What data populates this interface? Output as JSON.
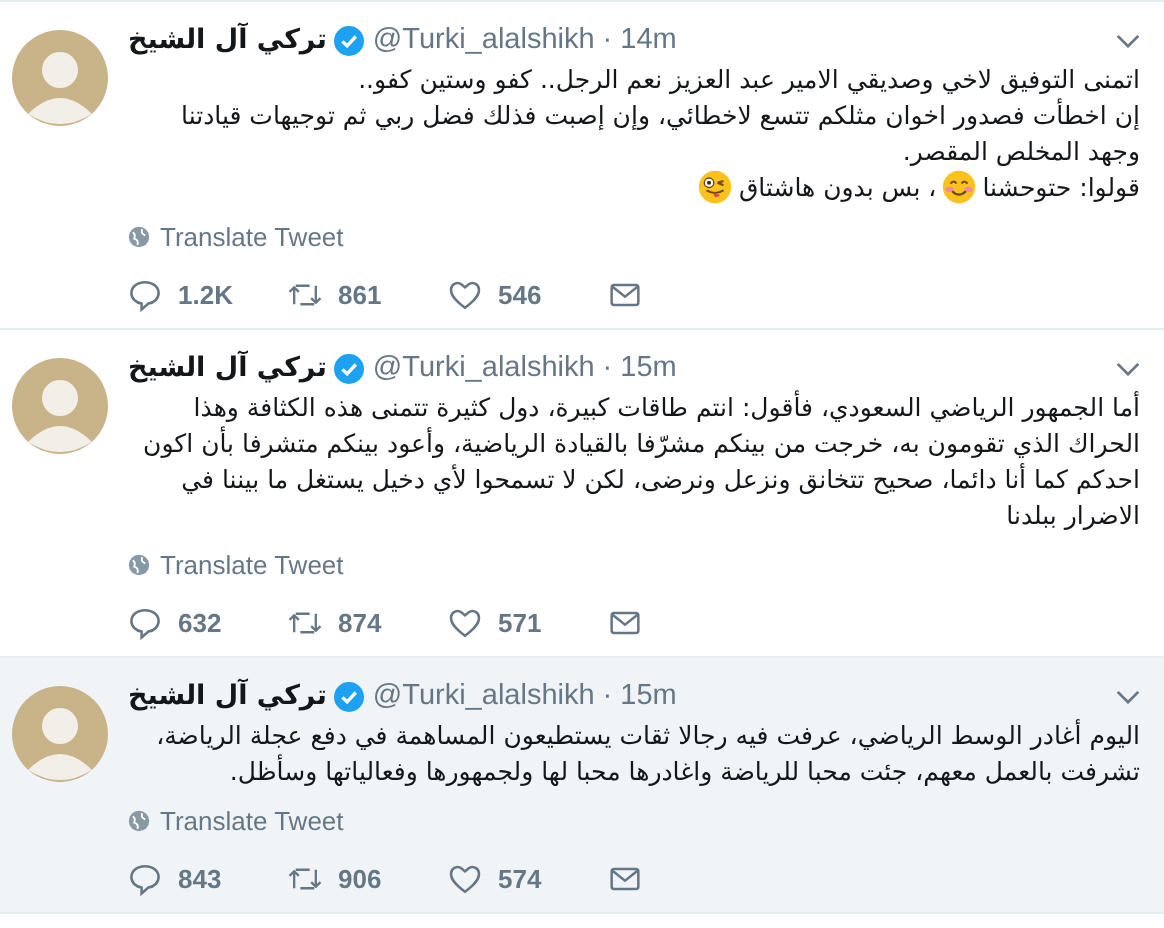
{
  "tweets": [
    {
      "name": "تركي آل الشيخ",
      "verified": true,
      "handle": "@Turki_alalshikh",
      "time": "· 14m",
      "highlighted": false,
      "paragraphs": [
        [
          {
            "kind": "text",
            "text": "اتمنى التوفيق لاخي وصديقي الامير عبد العزيز نعم الرجل.. كفو وستين كفو.."
          }
        ],
        [
          {
            "kind": "text",
            "text": "إن اخطأت فصدور اخوان مثلكم تتسع لاخطائي، وإن إصبت فذلك فضل ربي ثم توجيهات قيادتنا وجهد المخلص المقصر."
          }
        ],
        [
          {
            "kind": "text",
            "text": "قولوا: حتوحشنا"
          },
          {
            "kind": "smile"
          },
          {
            "kind": "text",
            "text": "، بس بدون هاشتاق"
          },
          {
            "kind": "wink"
          }
        ]
      ],
      "translate": "Translate Tweet",
      "replies": "1.2K",
      "retweets": "861",
      "likes": "546"
    },
    {
      "name": "تركي آل الشيخ",
      "verified": true,
      "handle": "@Turki_alalshikh",
      "time": "· 15m",
      "highlighted": false,
      "paragraphs": [
        [
          {
            "kind": "text",
            "text": "أما الجمهور الرياضي السعودي، فأقول: انتم طاقات كبيرة، دول كثيرة تتمنى هذه الكثافة وهذا الحراك الذي تقومون به، خرجت من بينكم مشرّفا بالقيادة الرياضية، وأعود بينكم متشرفا بأن اكون احدكم كما أنا دائما، صحيح تتخانق ونزعل ونرضى، لكن لا تسمحوا لأي دخيل يستغل ما بيننا في الاضرار ببلدنا"
          }
        ]
      ],
      "translate": "Translate Tweet",
      "replies": "632",
      "retweets": "874",
      "likes": "571"
    },
    {
      "name": "تركي آل الشيخ",
      "verified": true,
      "handle": "@Turki_alalshikh",
      "time": "· 15m",
      "highlighted": true,
      "paragraphs": [
        [
          {
            "kind": "text",
            "text": "اليوم أغادر الوسط الرياضي، عرفت فيه رجالا ثقات يستطيعون المساهمة في دفع عجلة الرياضة، تشرفت بالعمل معهم، جئت محبا للرياضة واغادرها محبا لها ولجمهورها وفعالياتها وسأظل."
          }
        ]
      ],
      "translate": "Translate Tweet",
      "replies": "843",
      "retweets": "906",
      "likes": "574"
    }
  ]
}
